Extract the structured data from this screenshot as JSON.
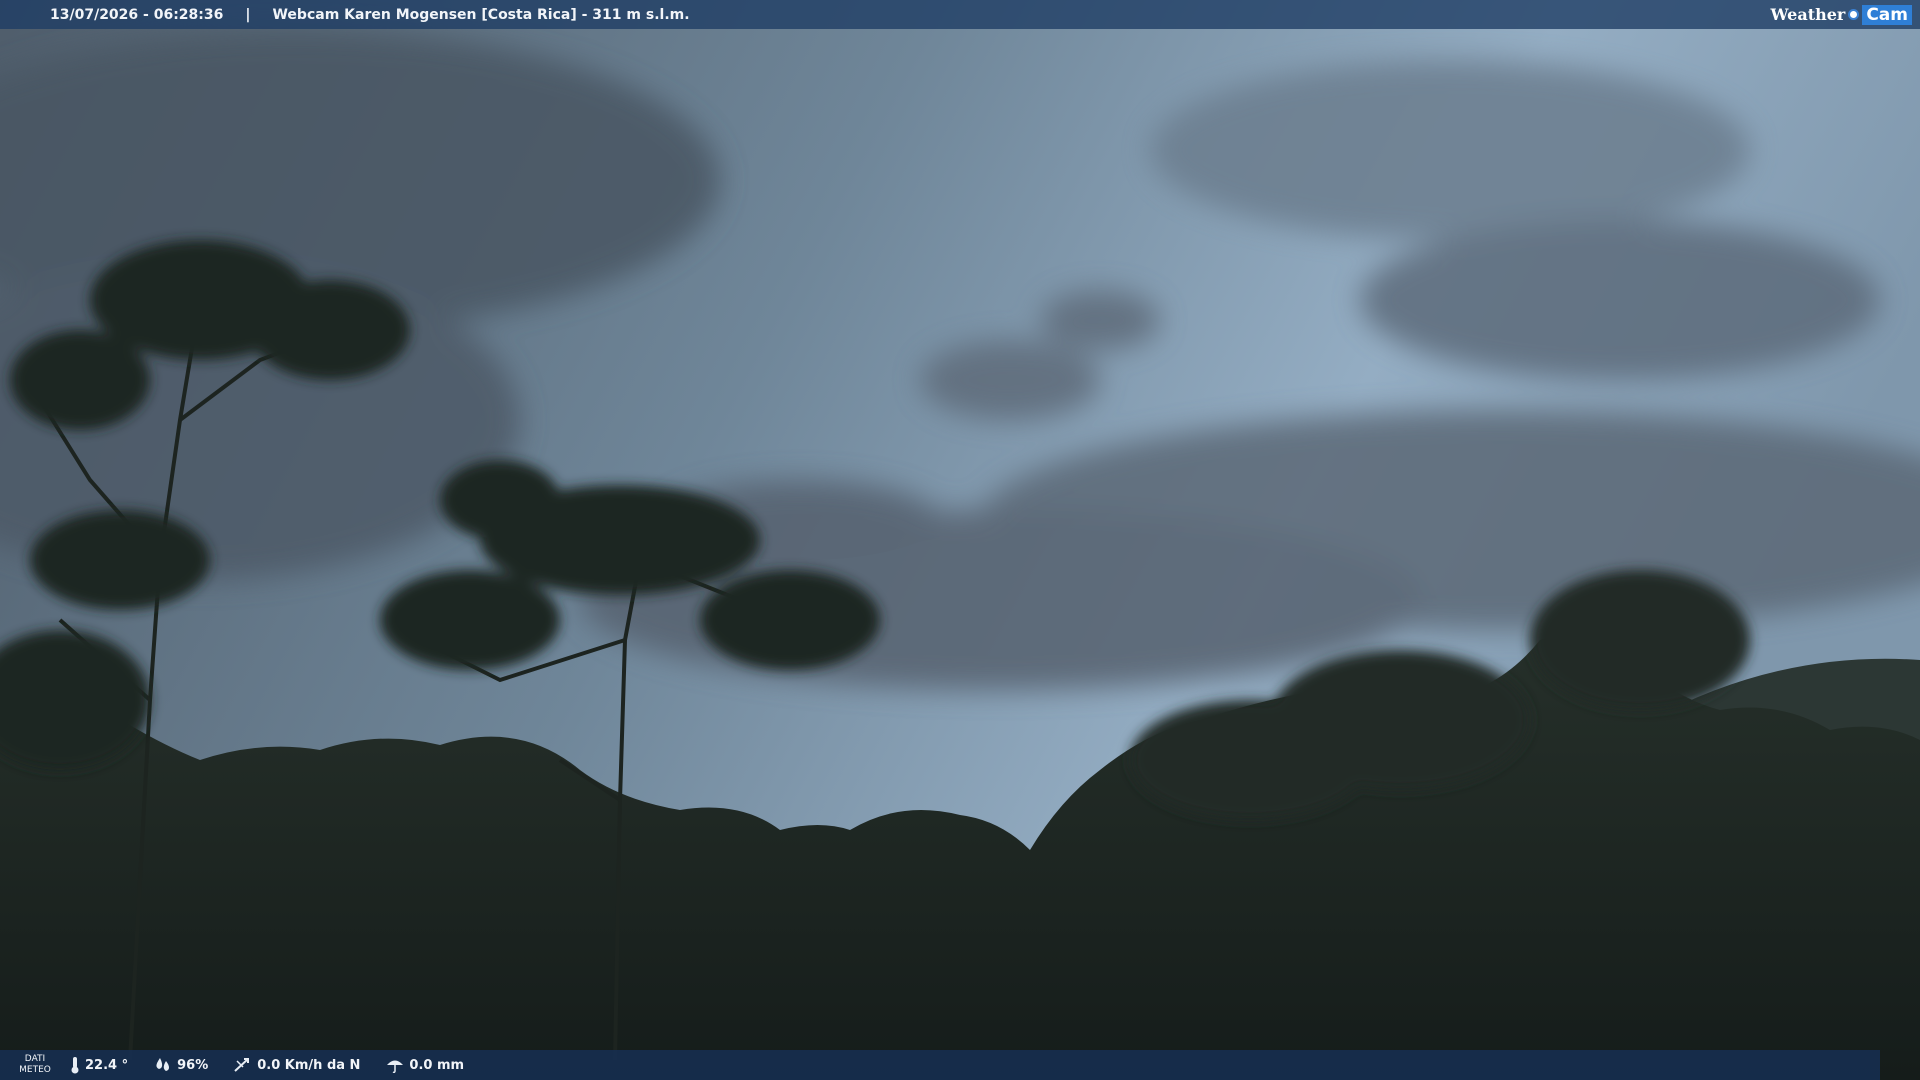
{
  "header": {
    "timestamp": "13/07/2026 - 06:28:36",
    "separator": "|",
    "title": "Webcam Karen Mogensen [Costa Rica] - 311 m s.l.m.",
    "logo_left": "Weather",
    "logo_right": "Cam"
  },
  "footer": {
    "dati_label_line1": "DATI",
    "dati_label_line2": "METEO",
    "temperature": "22.4 °",
    "humidity": "96%",
    "wind": "0.0 Km/h da N",
    "rain": "0.0 mm"
  },
  "icons": {
    "temperature": "thermometer-icon",
    "humidity": "humidity-drops-icon",
    "wind": "wind-icon",
    "rain": "rain-umbrella-icon"
  },
  "colors": {
    "sky_top": "#5f7487",
    "sky_mid": "#8aa5bd",
    "cloud_dark": "#55606c",
    "foliage": "#1c2520",
    "bar": "#1e3c64",
    "logo_accent": "#2f7fd6"
  }
}
